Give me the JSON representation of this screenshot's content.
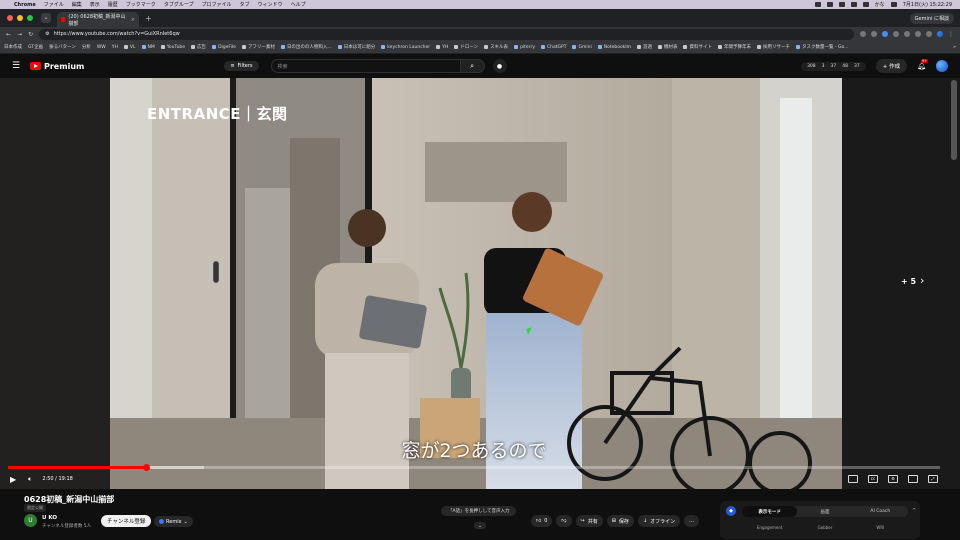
{
  "menubar": {
    "app": "Chrome",
    "items": [
      "ファイル",
      "編集",
      "表示",
      "履歴",
      "ブックマーク",
      "タブグループ",
      "プロファイル",
      "タブ",
      "ウィンドウ",
      "ヘルプ"
    ],
    "right_text": "かな",
    "datetime": "7月1日(火) 15:22:29"
  },
  "browser": {
    "tab_title": "(20) 0628初稿_新潟中山揃部",
    "url": "https://www.youtube.com/watch?v=GuiXRnIet6qw",
    "gemini_label": "Gemini に相談",
    "bookmarks": [
      "日本作成",
      "GT企画",
      "振るバターン",
      "分析",
      "WW",
      "YH",
      "VL",
      "NM",
      "YouTube",
      "広告",
      "DigeFile",
      "アフリー素材",
      "日の出のの人物和入...",
      "日本は可に組分",
      "keychron Launcher",
      "YH",
      "ドローン",
      "スキル表",
      "piterry",
      "ChatGPT",
      "Gmini",
      "Notebooklm",
      "首週",
      "機材表",
      "資料サイト",
      "年間予算年末",
      "採用リサーチ",
      "タスク数量一覧 - Go..."
    ]
  },
  "youtube": {
    "logo_text": "Premium",
    "filters_label": "Filters",
    "search_placeholder": "検索",
    "stats": [
      "308",
      "3",
      "37",
      "48",
      "37"
    ],
    "create_label": "作成",
    "notif_count": "9+"
  },
  "video": {
    "overlay_title": "ENTRANCE｜玄関",
    "subtitle": "窓が2つあるので",
    "more_label": "+ 5",
    "current_time": "2:50",
    "duration": "19:18",
    "time_display": "2:50 / 19:18",
    "progress_fraction": 0.148,
    "buffered_fraction": 0.21
  },
  "details": {
    "title": "0628初稿_新潟中山揃部",
    "visibility": "限定公開",
    "channel_initial": "U",
    "channel_name": "U KO",
    "channel_subs": "チャンネル登録者数 5人",
    "subscribe_label": "チャンネル登録",
    "remix_label": "Remix",
    "voice_hint": "「A話」を長押しして音声入力",
    "voice_chevron": "⌄",
    "like_count": "0",
    "share_label": "共有",
    "save_label": "保存",
    "offline_label": "オフライン",
    "more_label": "…"
  },
  "mode_panel": {
    "tabs": [
      "表示モード",
      "画面",
      "AI Coach"
    ],
    "labels": [
      "Engagement",
      "Gobber",
      "WRI"
    ]
  },
  "colors": {
    "accent_red": "#ff0000",
    "page_bg": "#0f0f0f",
    "cursor_green": "#2bd93a"
  }
}
